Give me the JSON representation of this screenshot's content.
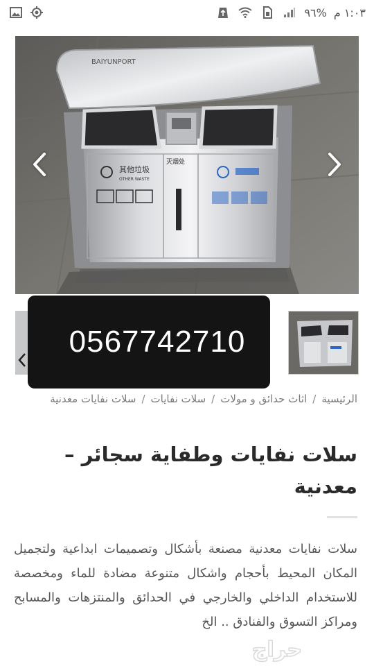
{
  "status_bar": {
    "time": "١:٠٣ م",
    "battery": "%٩٦",
    "icons": [
      "signal-icon",
      "sim-icon",
      "wifi-icon",
      "recycle-icon",
      "location-target-icon",
      "image-icon"
    ]
  },
  "gallery": {
    "main_image_desc": "stainless steel waste bin",
    "main_image_logo": "BAIYUNPORT",
    "main_image_chinese_label": "其他垃圾",
    "main_image_english_label": "OTHER WASTE",
    "main_image_ashtray_label": "灭烟处",
    "prev_icon": "chevron-left-icon",
    "next_icon": "chevron-right-icon"
  },
  "overlay": {
    "phone": "0567742710"
  },
  "breadcrumb": {
    "items": [
      "الرئيسية",
      "اثاث حدائق و مولات",
      "سلات نفايات",
      "سلات نفايات معدنية"
    ],
    "separator": "/"
  },
  "product": {
    "title": "سلات نفايات وطفاية سجائر – معدنية",
    "description": "سلات نفايات معدنية مصنعة بأشكال وتصميمات ابداعية ولتجميل المكان المحيط بأحجام واشكال متنوعة مضادة للماء ومخصصة للاستخدام الداخلي والخارجي في الحدائق والمنتزهات والمسابح ومراكز التسوق والفنادق .. الخ"
  },
  "watermark": {
    "text": "حراج"
  }
}
